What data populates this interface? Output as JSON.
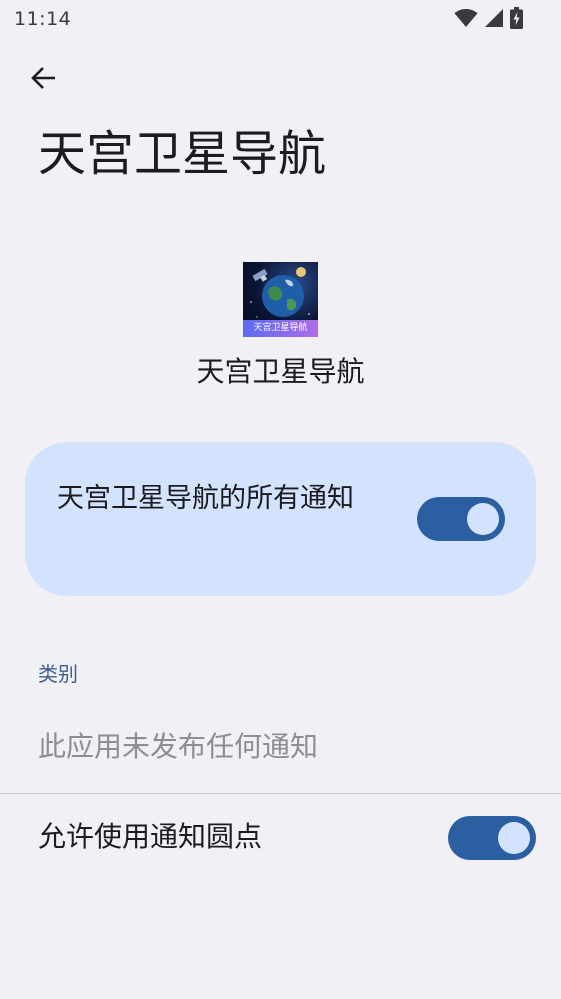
{
  "status_bar": {
    "time": "11:14",
    "icons": [
      "wifi-icon",
      "cellular-signal-icon",
      "battery-charging-icon"
    ]
  },
  "header": {
    "back_icon": "arrow-back-icon",
    "title": "天宫卫星导航"
  },
  "app": {
    "name": "天宫卫星导航",
    "icon_banner_text": "天宫卫星导航"
  },
  "main_card": {
    "label": "天宫卫星导航的所有通知",
    "toggle_on": true
  },
  "categories": {
    "header": "类别",
    "empty_message": "此应用未发布任何通知"
  },
  "notification_dots": {
    "label": "允许使用通知圆点",
    "toggle_on": true
  },
  "colors": {
    "background": "#f1f0f5",
    "card": "#d3e3fd",
    "toggle_track": "#2b5fa2",
    "category_accent": "#3c5f92"
  }
}
